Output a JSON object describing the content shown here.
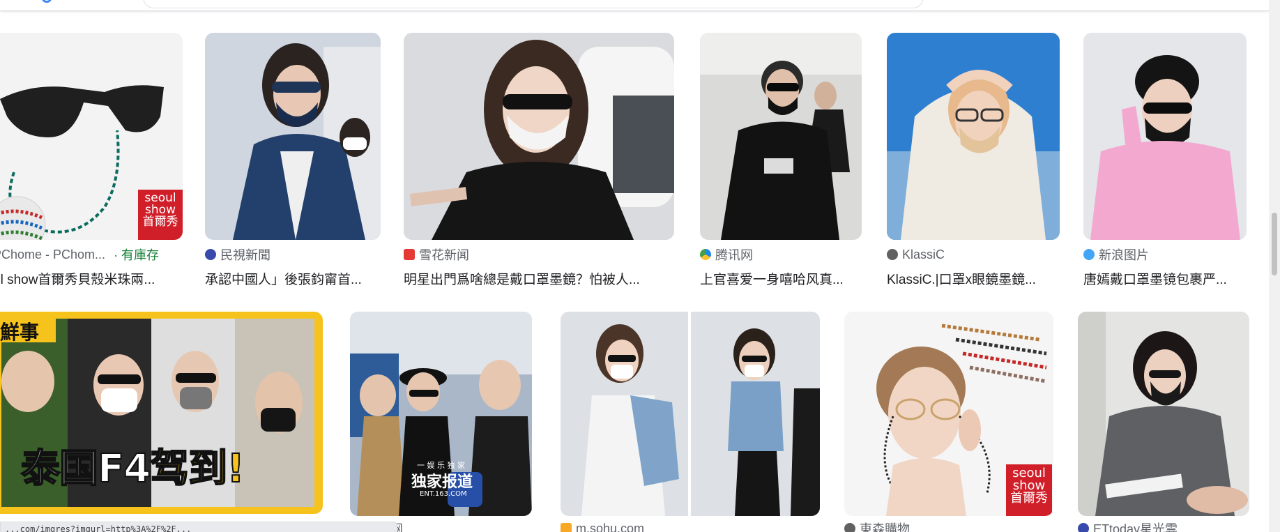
{
  "row1": [
    {
      "source": "PChome - PChom...",
      "stock": "· 有庫存",
      "title": "ul show首爾秀貝殼米珠兩...",
      "favicon_color": "#e53935",
      "watermark": [
        "seoul",
        "show",
        "首爾秀"
      ]
    },
    {
      "source": "民視新聞",
      "title": "承認中國人」後張鈞甯首...",
      "favicon_color": "#3949ab"
    },
    {
      "source": "雪花新闻",
      "title": "明星出門爲啥總是戴口罩墨鏡？怕被人...",
      "favicon_color": "#e53935"
    },
    {
      "source": "腾讯网",
      "title": "上官喜爱一身嘻哈风真...",
      "favicon_color": "#1e88e5"
    },
    {
      "source": "KlassiC",
      "title": "KlassiC.|口罩x眼鏡墨鏡...",
      "favicon_color": "#616161"
    },
    {
      "source": "新浪图片",
      "title": "唐嫣戴口罩墨镜包裹严...",
      "favicon_color": "#42a5f5"
    }
  ],
  "row2": [
    {
      "banner_top": "鮮事",
      "banner_main": "泰国F4",
      "banner_main2": "驾到!"
    },
    {
      "source": "网",
      "overlay_small": "一 娱 乐 独 家",
      "overlay": "独家报道",
      "overlay_sub": "ENT.163.COM",
      "favicon_color": "#9e9e9e"
    },
    {
      "source": "m.sohu.com",
      "favicon_color": "#f9a825"
    },
    {
      "source": "東森購物",
      "favicon_color": "#616161",
      "watermark": [
        "seoul",
        "show",
        "首爾秀"
      ]
    },
    {
      "source": "ETtoday星光雲",
      "favicon_color": "#3949ab"
    }
  ],
  "status_url": "...com/imgres?imgurl=http%3A%2F%2F...",
  "colors": {
    "accent": "#1a73e8",
    "stock_green": "#188038",
    "watermark_red": "#d11f2a",
    "banner_yellow": "#f6c21c"
  }
}
